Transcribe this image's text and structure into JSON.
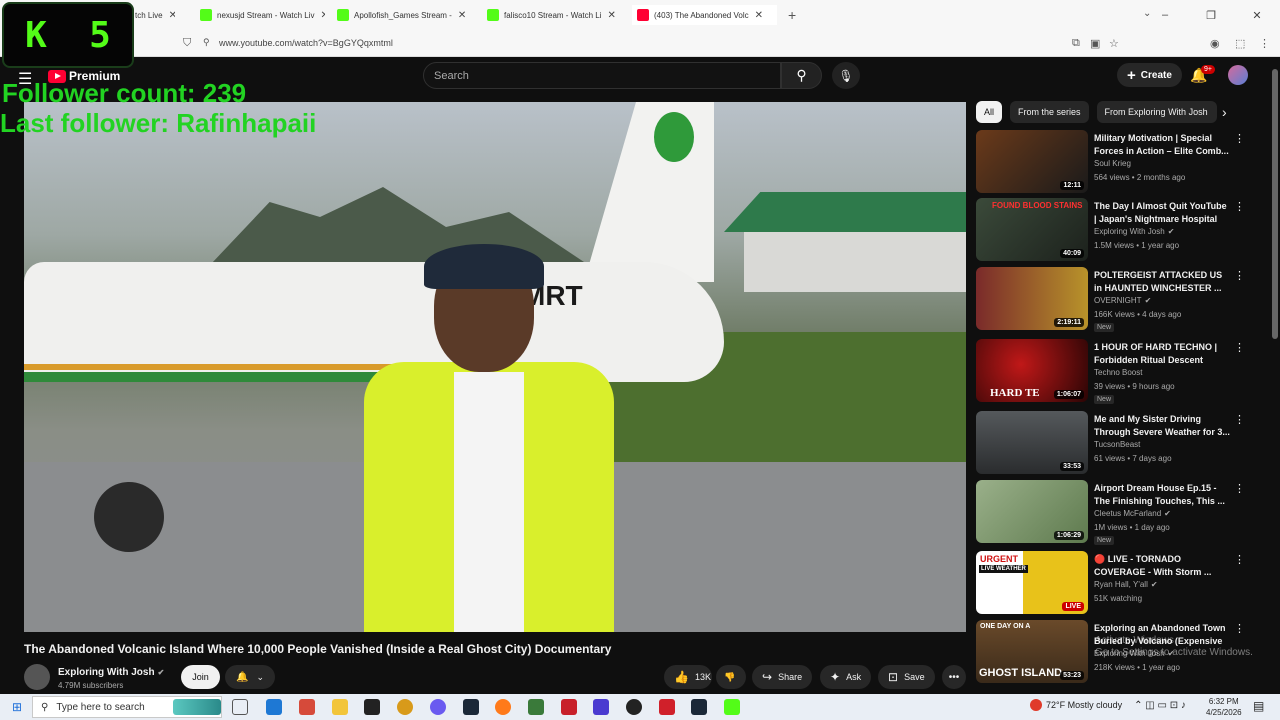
{
  "browser": {
    "tabs": [
      {
        "label": "tch Live",
        "favicon": "kick"
      },
      {
        "label": "nexusjd Stream - Watch Liv",
        "favicon": "kick"
      },
      {
        "label": "Apollofish_Games Stream -",
        "favicon": "kick"
      },
      {
        "label": "falisco10 Stream - Watch Li",
        "favicon": "kick"
      },
      {
        "label": "(403) The Abandoned Volc",
        "favicon": "youtube",
        "active": true
      }
    ],
    "new_tab": "+",
    "url": "www.youtube.com/watch?v=BgGYQqxmtml",
    "window_controls": {
      "minimize": "–",
      "restore": "❐",
      "close": "✕"
    }
  },
  "overlay": {
    "k_letter": "K",
    "k_number": "5",
    "follower_count": "Follower count: 239",
    "last_follower": "Last follower: Rafinhapaii"
  },
  "youtube": {
    "logo_label": "Premium",
    "search_placeholder": "Search",
    "create_label": "Create",
    "notification_badge": "9+",
    "video": {
      "title": "The Abandoned Volcanic Island Where 10,000 People Vanished (Inside a Real Ghost City) Documentary",
      "overlay_text": "P-MRT",
      "channel": "Exploring With Josh",
      "subscribers": "4.79M subscribers",
      "join_label": "Join",
      "likes": "13K",
      "share_label": "Share",
      "ask_label": "Ask",
      "save_label": "Save"
    },
    "chips": [
      "All",
      "From the series",
      "From Exploring With Josh"
    ],
    "recommendations": [
      {
        "title": "Military Motivation | Special Forces in Action – Elite Comb...",
        "channel": "Soul Krieg",
        "meta": "564 views • 2 months ago",
        "duration": "12:11",
        "new": "",
        "thumb_color": "#6b3a1a"
      },
      {
        "title": "The Day I Almost Quit YouTube | Japan's Nightmare Hospital",
        "channel": "Exploring With Josh",
        "meta": "1.5M views • 1 year ago",
        "duration": "40:09",
        "new": "",
        "thumb_color": "#3b4a3a"
      },
      {
        "title": "POLTERGEIST ATTACKED US in HAUNTED WINCHESTER ...",
        "channel": "OVERNIGHT",
        "meta": "166K views • 4 days ago",
        "duration": "2:19:11",
        "new": "New",
        "thumb_color": "#7a2a2a"
      },
      {
        "title": "1 HOUR OF HARD TECHNO | Forbidden Ritual Descent",
        "channel": "Techno Boost",
        "meta": "39 views • 9 hours ago",
        "duration": "1:06:07",
        "new": "New",
        "thumb_color": "#5a0a0a"
      },
      {
        "title": "Me and My Sister Driving Through Severe Weather for 3...",
        "channel": "TucsonBeast",
        "meta": "61 views • 7 days ago",
        "duration": "33:53",
        "new": "",
        "thumb_color": "#3a3d40"
      },
      {
        "title": "Airport Dream House Ep.15 - The Finishing Touches, This ...",
        "channel": "Cleetus McFarland",
        "meta": "1M views • 1 day ago",
        "duration": "1:06:29",
        "new": "New",
        "thumb_color": "#7d9a6a"
      },
      {
        "title": "🔴 LIVE - TORNADO COVERAGE - With Storm ...",
        "channel": "Ryan Hall, Y'all",
        "meta": "51K watching",
        "duration": "LIVE",
        "new": "",
        "thumb_color": "#b8a01a"
      },
      {
        "title": "Exploring an Abandoned Town Buried by Volcano (Expensive ...",
        "channel": "Exploring With Josh",
        "meta": "218K views • 1 year ago",
        "duration": "53:23",
        "new": "",
        "thumb_color": "#6a4a2a"
      }
    ],
    "thumb_text": {
      "rec2": "FOUND BLOOD STAINS",
      "rec4": "HARD TE",
      "rec7a": "URGENT",
      "rec7b": "LIVE WEATHER",
      "rec8a": "ONE DAY ON A",
      "rec8b": "GHOST ISLAND"
    }
  },
  "watermark": {
    "line1": "Activate Windows",
    "line2": "Go to Settings to activate Windows."
  },
  "taskbar": {
    "search_placeholder": "Type here to search",
    "weather": "72°F  Mostly cloudy",
    "time": "6:32 PM",
    "date": "4/25/2026"
  },
  "colors": {
    "youtube_red": "#ff0033",
    "kick_green": "#53fc18",
    "overlay_green": "#22d322",
    "background": "#0f0f0f"
  }
}
